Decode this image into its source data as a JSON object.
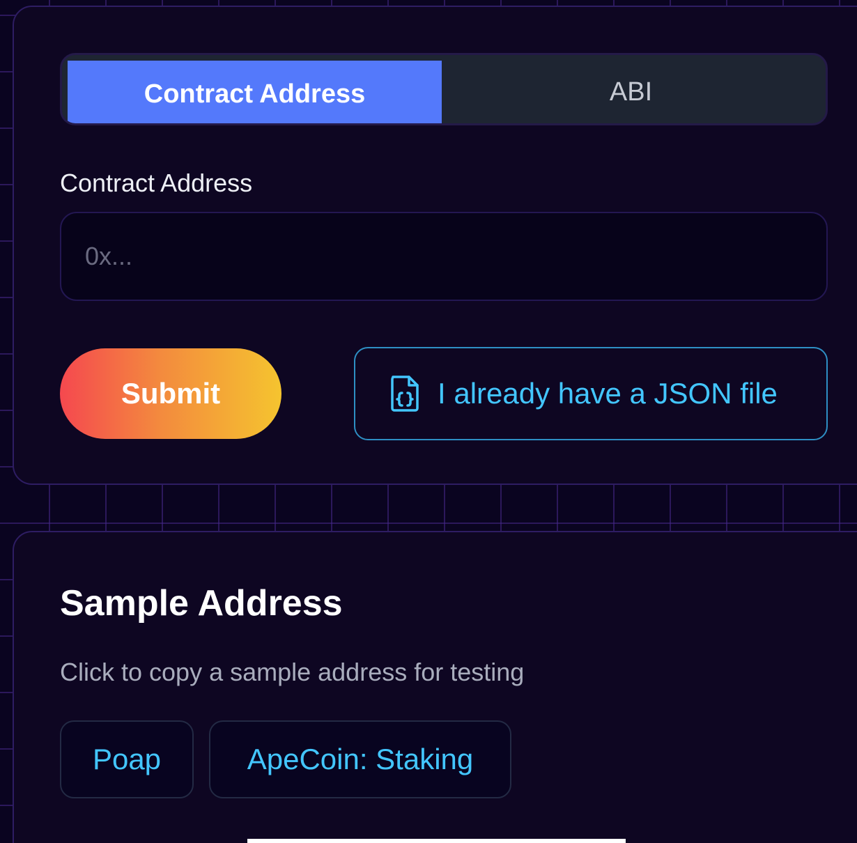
{
  "colors": {
    "accent_blue": "#5479fb",
    "link_cyan": "#43c6ff",
    "background": "#0a0420",
    "card": "#0e0622",
    "submit_gradient_start": "#f5484f",
    "submit_gradient_end": "#f5c42f"
  },
  "tabs": [
    {
      "label": "Contract Address",
      "selected": true
    },
    {
      "label": "ABI",
      "selected": false
    }
  ],
  "form": {
    "label": "Contract Address",
    "input_value": "",
    "input_placeholder": "0x...",
    "submit_label": "Submit",
    "json_button_label": "I already have a JSON file",
    "json_button_icon": "file-code-icon"
  },
  "samples": {
    "title": "Sample Address",
    "description": "Click to copy a sample address for testing",
    "items": [
      {
        "label": "Poap"
      },
      {
        "label": "ApeCoin: Staking"
      }
    ]
  }
}
